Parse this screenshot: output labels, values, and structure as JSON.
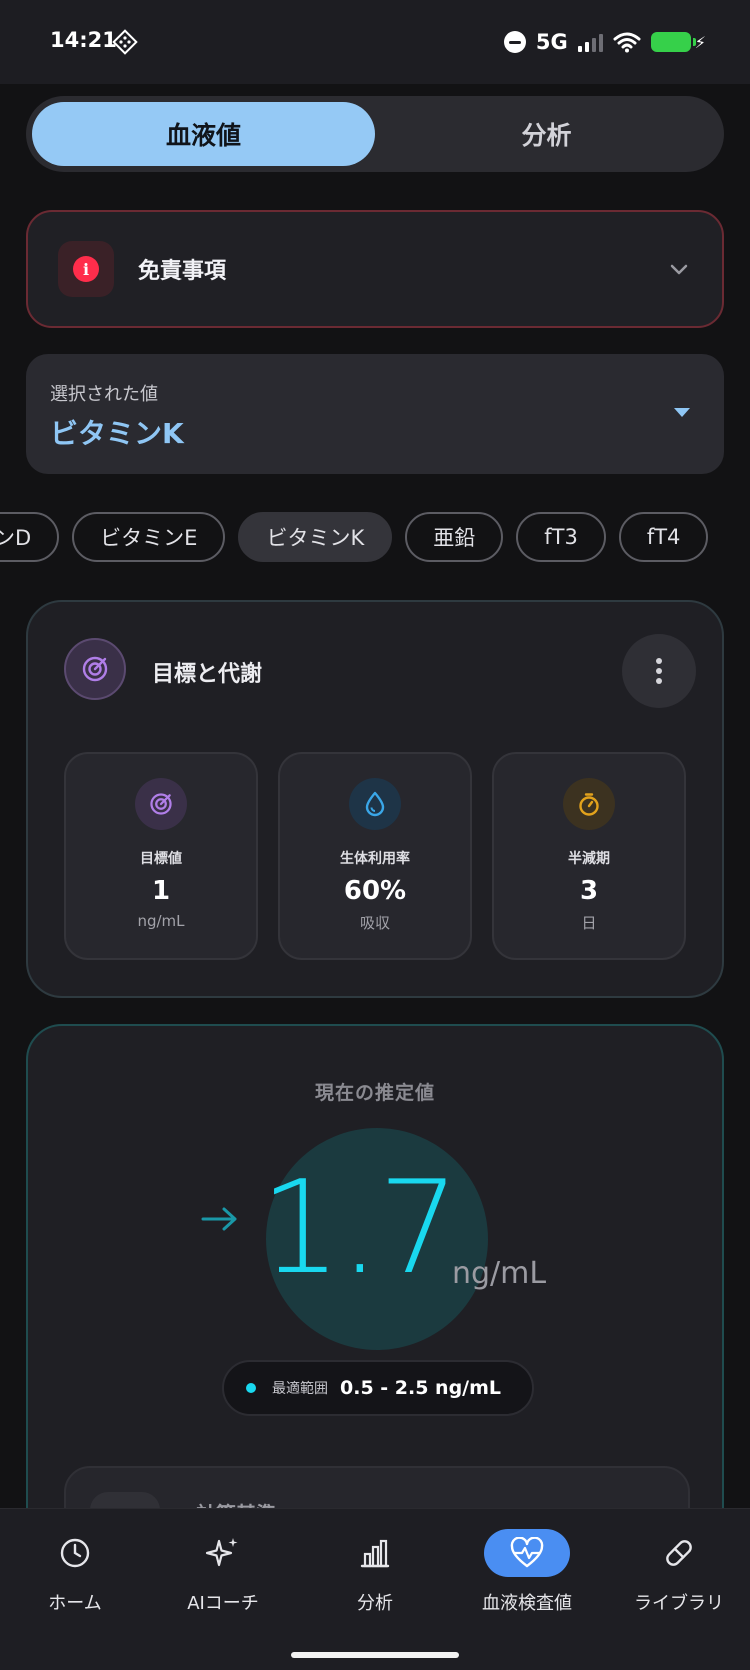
{
  "status": {
    "time": "14:21",
    "network": "5G"
  },
  "segments": [
    {
      "label": "血液値",
      "active": true
    },
    {
      "label": "分析",
      "active": false
    }
  ],
  "disclaimer": {
    "title": "免責事項",
    "icon": "info-icon"
  },
  "selector": {
    "label": "選択された値",
    "value": "ビタミンK"
  },
  "chips": [
    "ンD",
    "ビタミンE",
    "ビタミンK",
    "亜鉛",
    "fT3",
    "fT4"
  ],
  "chips_active_index": 2,
  "goals": {
    "title": "目標と代謝",
    "stats": [
      {
        "label": "目標値",
        "value": "1",
        "unit": "ng/mL",
        "icon": "target-icon",
        "color": "#b07ee8"
      },
      {
        "label": "生体利用率",
        "value": "60%",
        "unit": "吸収",
        "icon": "droplet-icon",
        "color": "#3aa7e8"
      },
      {
        "label": "半減期",
        "value": "3",
        "unit": "日",
        "icon": "timer-icon",
        "color": "#e2a21c"
      }
    ]
  },
  "estimate": {
    "title": "現在の推定値",
    "value": "1.7",
    "unit": "ng/mL",
    "range_label": "最適範囲",
    "range_value": "0.5 - 2.5 ng/mL",
    "accent": "#19d8ef"
  },
  "basis": {
    "title": "計算基準"
  },
  "nav": [
    {
      "label": "ホーム",
      "icon": "clock-icon"
    },
    {
      "label": "AIコーチ",
      "icon": "sparkles-icon"
    },
    {
      "label": "分析",
      "icon": "bar-chart-icon"
    },
    {
      "label": "血液検査値",
      "icon": "heart-pulse-icon",
      "active": true
    },
    {
      "label": "ライブラリ",
      "icon": "pill-icon"
    }
  ]
}
